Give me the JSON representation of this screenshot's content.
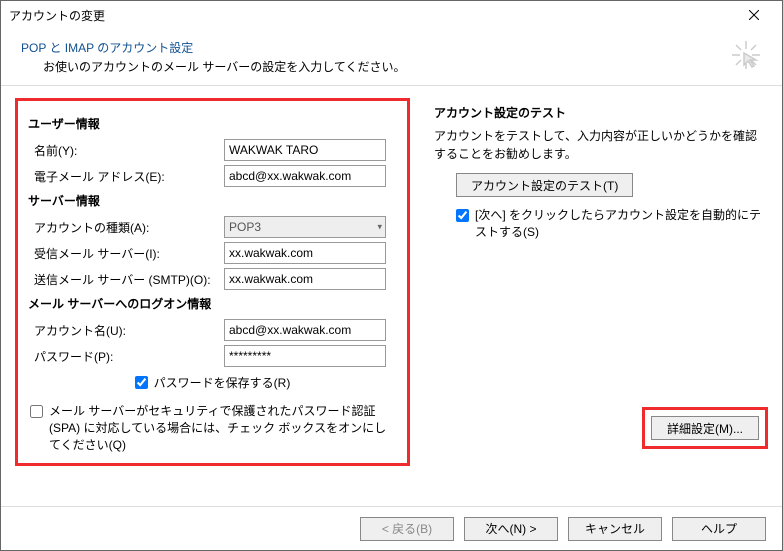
{
  "window": {
    "title": "アカウントの変更"
  },
  "header": {
    "title": "POP と IMAP のアカウント設定",
    "subtitle": "お使いのアカウントのメール サーバーの設定を入力してください。"
  },
  "sections": {
    "user_info": "ユーザー情報",
    "server_info": "サーバー情報",
    "logon_info": "メール サーバーへのログオン情報"
  },
  "labels": {
    "name": "名前(Y):",
    "email": "電子メール アドレス(E):",
    "account_type": "アカウントの種類(A):",
    "incoming": "受信メール サーバー(I):",
    "outgoing": "送信メール サーバー (SMTP)(O):",
    "account_name": "アカウント名(U):",
    "password": "パスワード(P):",
    "save_password": "パスワードを保存する(R)",
    "spa": "メール サーバーがセキュリティで保護されたパスワード認証 (SPA) に対応している場合には、チェック ボックスをオンにしてください(Q)"
  },
  "values": {
    "name": "WAKWAK TARO",
    "email": "abcd@xx.wakwak.com",
    "account_type": "POP3",
    "incoming": "xx.wakwak.com",
    "outgoing": "xx.wakwak.com",
    "account_name": "abcd@xx.wakwak.com",
    "password": "*********"
  },
  "right": {
    "test_head": "アカウント設定のテスト",
    "test_desc": "アカウントをテストして、入力内容が正しいかどうかを確認することをお勧めします。",
    "test_button": "アカウント設定のテスト(T)",
    "auto_test": "[次へ] をクリックしたらアカウント設定を自動的にテストする(S)",
    "advanced": "詳細設定(M)..."
  },
  "footer": {
    "back": "< 戻る(B)",
    "next": "次へ(N) >",
    "cancel": "キャンセル",
    "help": "ヘルプ"
  }
}
